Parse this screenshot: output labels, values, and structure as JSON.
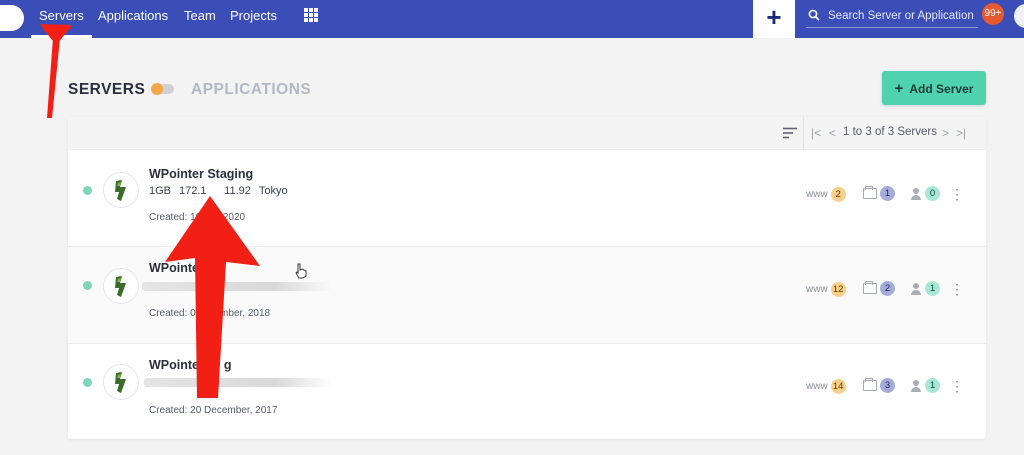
{
  "nav": {
    "items": [
      {
        "label": "Servers"
      },
      {
        "label": "Applications"
      },
      {
        "label": "Team"
      },
      {
        "label": "Projects"
      }
    ],
    "add_label": "+",
    "search_placeholder": "Search Server or Application",
    "notifications": "99+"
  },
  "page": {
    "title_servers": "SERVERS",
    "title_applications": "APPLICATIONS",
    "add_server_label": "Add Server",
    "add_server_plus": "+"
  },
  "toolbar": {
    "first": "|<",
    "prev": "<",
    "pager_text": "1 to 3 of 3 Servers",
    "next": ">",
    "last": ">|"
  },
  "servers": [
    {
      "name": "WPointer Staging",
      "size": "1GB",
      "ip": "172.1        11.92",
      "location": "Tokyo",
      "created": "Created: 19          2020",
      "www": "2",
      "folders": "1",
      "users": "0"
    },
    {
      "name": "WPointe",
      "created": "Created: 07         mber, 2018",
      "www": "12",
      "folders": "2",
      "users": "1"
    },
    {
      "name": "WPointer B   g",
      "created": "Created: 20 December, 2017",
      "www": "14",
      "folders": "3",
      "users": "1"
    }
  ],
  "labels": {
    "www": "www",
    "kebab": "⋮"
  },
  "colors": {
    "nav_bg": "#3b4eb8",
    "accent_green": "#4fd2ae",
    "status_online": "#7ed6b8",
    "annotation_red": "#f21f14"
  }
}
